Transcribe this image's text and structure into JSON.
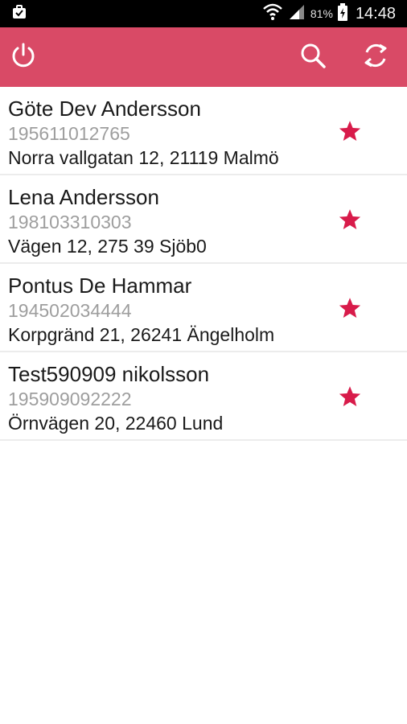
{
  "status_bar": {
    "battery_percent": "81%",
    "time": "14:48",
    "icons": [
      "briefcase-icon",
      "wifi-icon",
      "signal-icon",
      "battery-icon"
    ]
  },
  "app_bar": {
    "color": "#d94a66",
    "icons": [
      "power-icon",
      "search-icon",
      "refresh-icon"
    ]
  },
  "contacts": [
    {
      "name": "Göte Dev Andersson",
      "pnr": "195611012765",
      "address": "Norra vallgatan 12, 21119 Malmö",
      "favorite": true
    },
    {
      "name": "Lena Andersson",
      "pnr": "198103310303",
      "address": "Vägen 12, 275 39 Sjöb0",
      "favorite": true
    },
    {
      "name": "Pontus De Hammar",
      "pnr": "194502034444",
      "address": "Korpgränd 21, 26241 Ängelholm",
      "favorite": true
    },
    {
      "name": "Test590909 nikolsson",
      "pnr": "195909092222",
      "address": "Örnvägen 20, 22460 Lund",
      "favorite": true
    }
  ],
  "colors": {
    "accent": "#d94a66",
    "star": "#d81b4a"
  }
}
